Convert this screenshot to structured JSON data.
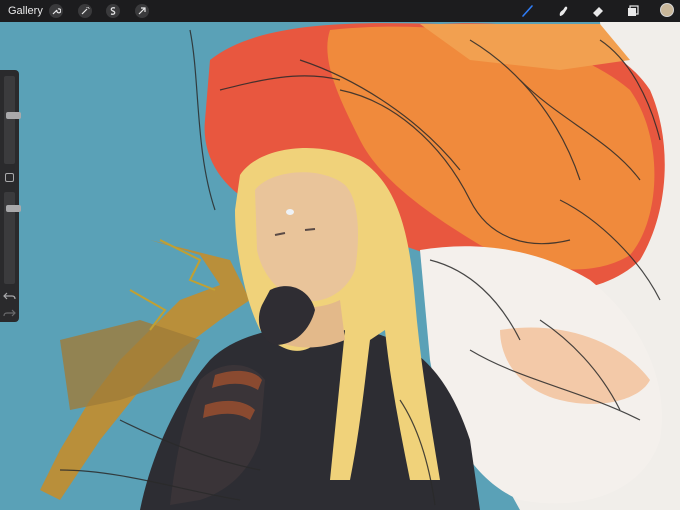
{
  "topbar": {
    "gallery_label": "Gallery",
    "left_tools": [
      "wrench-icon",
      "magic-wand-icon",
      "selection-icon",
      "transform-arrow-icon"
    ],
    "right_tools": [
      "brush-icon",
      "smudge-icon",
      "eraser-icon",
      "layers-icon"
    ],
    "active_tool": "brush-icon",
    "accent_color": "#2e7cf6",
    "current_color": "#c9b79a"
  },
  "sidebar": {
    "brush_size_level": 0.55,
    "opacity_level": 0.85
  },
  "artwork": {
    "background_color": "#5aa1b7",
    "palette": [
      "#e8573f",
      "#f08a3c",
      "#f2c56a",
      "#f3efea",
      "#2b2b30",
      "#c1a032"
    ]
  }
}
